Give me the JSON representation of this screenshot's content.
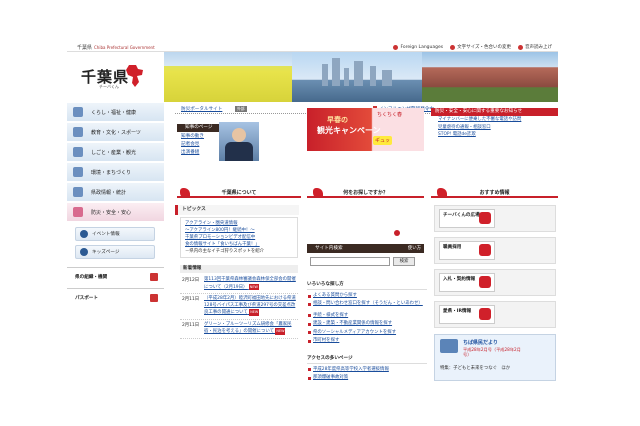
{
  "topbar": {
    "brand": "千葉県",
    "brand_en": "Chiba Prefectural Government",
    "links": [
      "Foreign Languages",
      "文字サイズ・色合いの変更",
      "音声読み上げ"
    ]
  },
  "logo": {
    "title": "千葉県",
    "subtitle": "チーバくん"
  },
  "sidebar": {
    "items": [
      {
        "label": "くらし・福祉・健康",
        "icon": "home-icon"
      },
      {
        "label": "教育・文化・スポーツ",
        "icon": "book-icon"
      },
      {
        "label": "しごと・産業・観光",
        "icon": "briefcase-icon"
      },
      {
        "label": "環境・まちづくり",
        "icon": "leaf-icon"
      },
      {
        "label": "県政情報・統計",
        "icon": "chart-icon"
      },
      {
        "label": "防災・安全・安心",
        "icon": "shield-icon"
      }
    ],
    "buttons": [
      {
        "label": "イベント情報",
        "icon": "calendar-icon"
      },
      {
        "label": "キッズページ",
        "icon": "kids-icon"
      }
    ],
    "links": [
      {
        "label": "県の組織・機関",
        "icon": "org-icon"
      },
      {
        "label": "パスポート",
        "icon": "passport-icon"
      }
    ]
  },
  "infobar": {
    "left_link": "防災ポータルサイト",
    "left_tag": "外部",
    "right_link": "インフルエンザ警報発令中"
  },
  "governor": {
    "heading": "知事のページ",
    "links": [
      "知事の動き",
      "記者会見",
      "出演番組"
    ]
  },
  "campaign": {
    "line1": "早春の",
    "line2": "観光キャンペーン",
    "side": "ちくちく春",
    "badge": "ギュッ"
  },
  "notices": {
    "heading": "防災・安全・安心に関する重要なお知らせ",
    "items": [
      "マイナンバーに便乗した不審な電話や訪問",
      "児童虐待の通報・相談窓口",
      "STOP! 電話de詐欺"
    ]
  },
  "sections": {
    "about": "千葉県について",
    "search": "何をお探しですか？",
    "recommend": "おすすめ情報"
  },
  "topics": {
    "heading": "トピックス",
    "items": [
      {
        "text": "アクアライン・圏央道情報",
        "sub": false
      },
      {
        "text": "～アクアライン800円！継続中！～",
        "sub": false
      },
      {
        "text": "千葉県プロモーションビデオ配信中",
        "sub": false
      },
      {
        "text": "食の情報サイト「食いちばん千葉！」",
        "sub": false
      },
      {
        "text": "－県内の主なイチゴ狩りスポットを紹介",
        "sub": true
      }
    ]
  },
  "news": {
    "heading": "新着情報",
    "items": [
      {
        "date": "2月12日",
        "title": "第113回千葉県森林審議会森林保全部会の開催について（2月19日）",
        "new": "NEW"
      },
      {
        "date": "2月11日",
        "title": "（平成28年2月）睦沢町福田地先における県道128号バイパス工事及び県道297号の交差点改良工事の開通について",
        "new": "NEW"
      },
      {
        "date": "2月11日",
        "title": "グリーン・ブルーツーリズム研修会「農家民宿・民泊を考える」の開催について",
        "new": "NEW"
      }
    ]
  },
  "search": {
    "heading": "サイト内検索",
    "help": "使い方",
    "button": "検索",
    "placeholder": ""
  },
  "popular": {
    "heading": "いろいろな探し方",
    "links": [
      "よくある質問から探す",
      "相談・問い合わせ窓口を探す（そうだん・といあわせ）",
      "手続・様式を探す",
      "建設・建築・不動産業関係の情報を探す",
      "県のソーシャルメディアアカウントを探す",
      "市町村を探す"
    ]
  },
  "access": {
    "heading": "アクセスの多いページ",
    "links": [
      "平成28年度県高等学校入学者選抜情報",
      "那須爆破事故対策"
    ]
  },
  "recommend": {
    "items": [
      "チーバくんの広場",
      "職員採用",
      "入札・契約情報",
      "愛県・IR情報"
    ]
  },
  "bookmark": {
    "title": "ちば県民だより",
    "sub": "平成28年2月号（平成28年2月号）",
    "foot": "特集：子どもと未来をつなぐ　ほか"
  }
}
